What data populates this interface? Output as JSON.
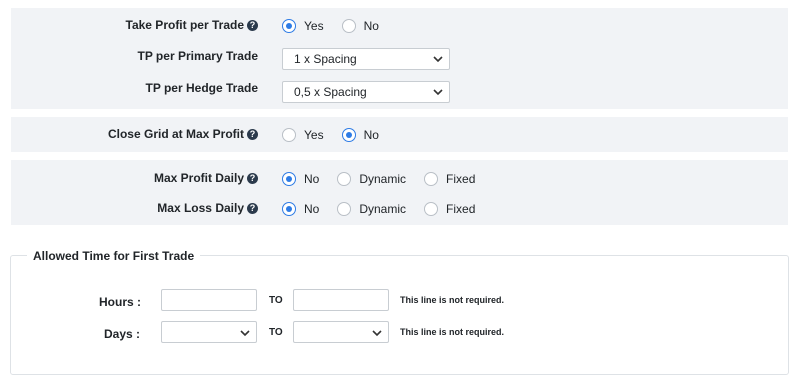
{
  "take_profit": {
    "label": "Take Profit per Trade",
    "options": [
      "Yes",
      "No"
    ],
    "selected": "Yes",
    "help_icon": "question-circle-icon"
  },
  "tp_primary": {
    "label": "TP per Primary Trade",
    "value": "1 x Spacing"
  },
  "tp_hedge": {
    "label": "TP per Hedge Trade",
    "value": "0,5 x Spacing"
  },
  "close_grid": {
    "label": "Close Grid at Max Profit",
    "options": [
      "Yes",
      "No"
    ],
    "selected": "No"
  },
  "max_profit_daily": {
    "label": "Max Profit Daily",
    "options": [
      "No",
      "Dynamic",
      "Fixed"
    ],
    "selected": "No"
  },
  "max_loss_daily": {
    "label": "Max Loss Daily",
    "options": [
      "No",
      "Dynamic",
      "Fixed"
    ],
    "selected": "No"
  },
  "allowed_time": {
    "legend": "Allowed Time for First Trade",
    "hours_label": "Hours :",
    "days_label": "Days :",
    "to_label": "TO",
    "note": "This line is not required.",
    "hours_from": "",
    "hours_to": "",
    "days_from": "",
    "days_to": ""
  },
  "colors": {
    "panel_bg": "#f1f3f6",
    "accent": "#2d7be5",
    "help_icon": "#2b3a4c"
  }
}
